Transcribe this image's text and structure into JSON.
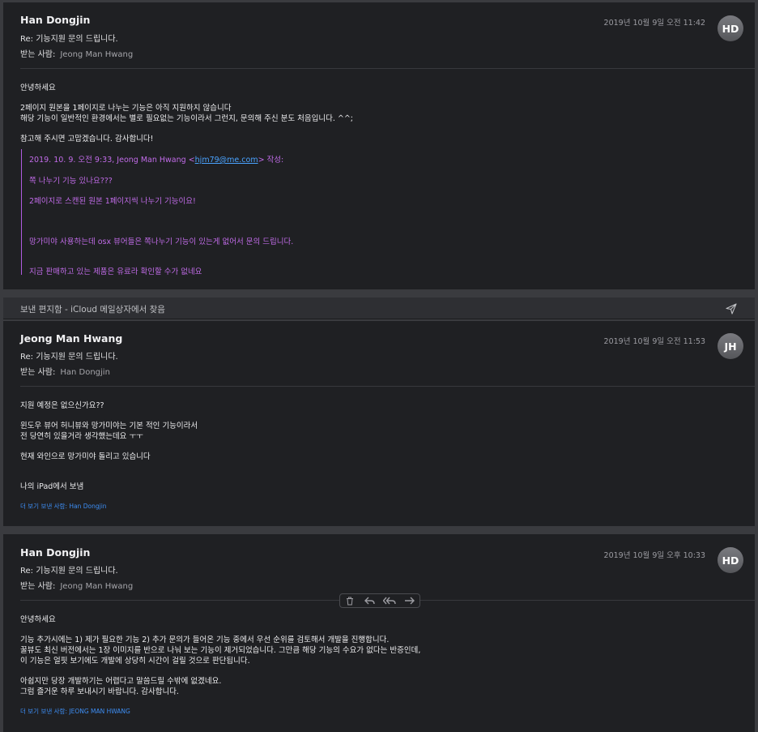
{
  "messages": [
    {
      "from": "Han Dongjin",
      "subject": "Re: 기능지원 문의 드립니다.",
      "to_label": "받는 사람:",
      "to": "Jeong Man Hwang",
      "date": "2019년 10월 9일 오전 11:42",
      "avatar": "HD",
      "body": [
        "안녕하세요",
        "2페이지 원본을 1페이지로 나누는 기능은 아직 지원하지 않습니다",
        "해당 기능이 일반적인 환경에서는 별로 필요없는 기능이라서 그런지, 문의해 주신 분도 처음입니다. ^^;",
        "참고해 주시면 고맙겠습니다. 감사합니다!"
      ],
      "quote": {
        "header_prefix": "2019. 10. 9. 오전 9:33, Jeong Man Hwang <",
        "header_email": "hjm79@me.com",
        "header_suffix": "> 작성:",
        "lines": [
          "쪽 나누기 기능 있나요???",
          "2페이지로 스캔된 원본 1페이지씩 나누기 기능이요!",
          "망가미야 사용하는데 osx 뷰어들은 쪽나누기 기능이 있는게 없어서 문의 드립니다.",
          "지금 판매하고 있는 제품은 유료라 확인할 수가 없네요"
        ]
      }
    },
    {
      "from": "Jeong Man Hwang",
      "subject": "Re: 기능지원 문의 드립니다.",
      "to_label": "받는 사람:",
      "to": "Han Dongjin",
      "date": "2019년 10월 9일 오전 11:53",
      "avatar": "JH",
      "body": [
        "지원 예정은 없으신가요??",
        "윈도우 뷰어 허니뷰와 망가미야는 기본 적인 기능이라서",
        "전 당연히 있을거라 생각했는데요 ㅜㅜ",
        "현재 와인으로 망가미야 돌리고 있습니다",
        "나의 iPad에서 보냄"
      ],
      "more": "더 보기 보낸 사람: Han Dongjin"
    },
    {
      "from": "Han Dongjin",
      "subject": "Re: 기능지원 문의 드립니다.",
      "to_label": "받는 사람:",
      "to": "Jeong Man Hwang",
      "date": "2019년 10월 9일 오후 10:33",
      "avatar": "HD",
      "body": [
        "안녕하세요",
        "기능 추가시에는 1) 제가 필요한 기능 2) 추가 문의가 들어온 기능 중에서 우선 순위를 검토해서 개발을 진행합니다.",
        "꿀뷰도 최신 버전에서는 1장 이미지를 반으로 나눠 보는 기능이 제거되었습니다. 그만큼 해당 기능의 수요가 없다는 반증인데,",
        "이 기능은 얼핏 보기에도 개발에 상당히 시간이 걸릴 것으로 판단됩니다.",
        "아쉽지만 당장 개발하기는 어렵다고 말씀드릴 수밖에 없겠네요.",
        "그럼 즐거운 하루 보내시기 바랍니다. 감사합니다."
      ],
      "more": "더 보기 보낸 사람: JEONG MAN HWANG"
    }
  ],
  "sent_bar": {
    "label": "보낸 편지함 - iCloud 메일상자에서 찾음",
    "icon": "send-icon"
  },
  "toolbar": {
    "icons": [
      "trash-icon",
      "reply-icon",
      "reply-all-icon",
      "forward-icon"
    ]
  },
  "colors": {
    "link": "#3d8ef5",
    "quote": "#c16be8",
    "background": "#1f2023"
  }
}
